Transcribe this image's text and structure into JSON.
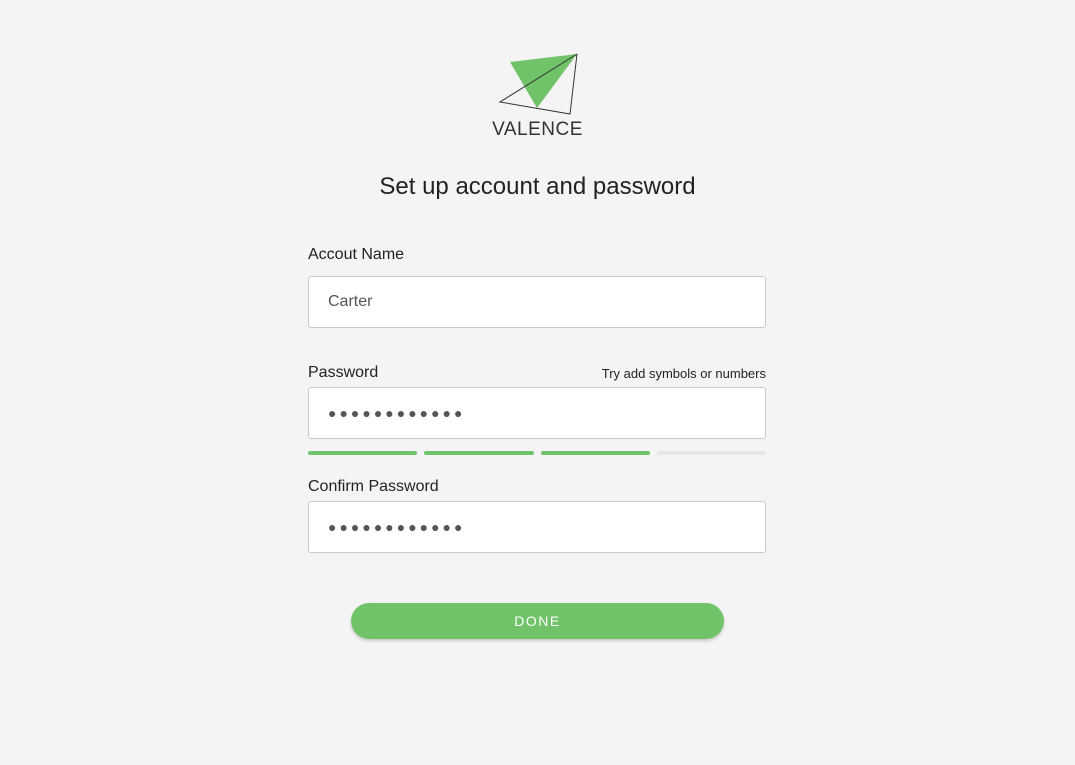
{
  "brand": {
    "name": "VALENCE",
    "logo_icon": "paper-plane-triangle-icon",
    "accent_color": "#71c36a"
  },
  "title": "Set up account and password",
  "form": {
    "account_name": {
      "label": "Accout Name",
      "value": "Carter"
    },
    "password": {
      "label": "Password",
      "hint": "Try add symbols or numbers",
      "value_masked": "●●●●●●●●●●●●",
      "strength_filled": 3,
      "strength_total": 4
    },
    "confirm_password": {
      "label": "Confirm Password",
      "value_masked": "●●●●●●●●●●●●"
    },
    "done_label": "DONE"
  }
}
